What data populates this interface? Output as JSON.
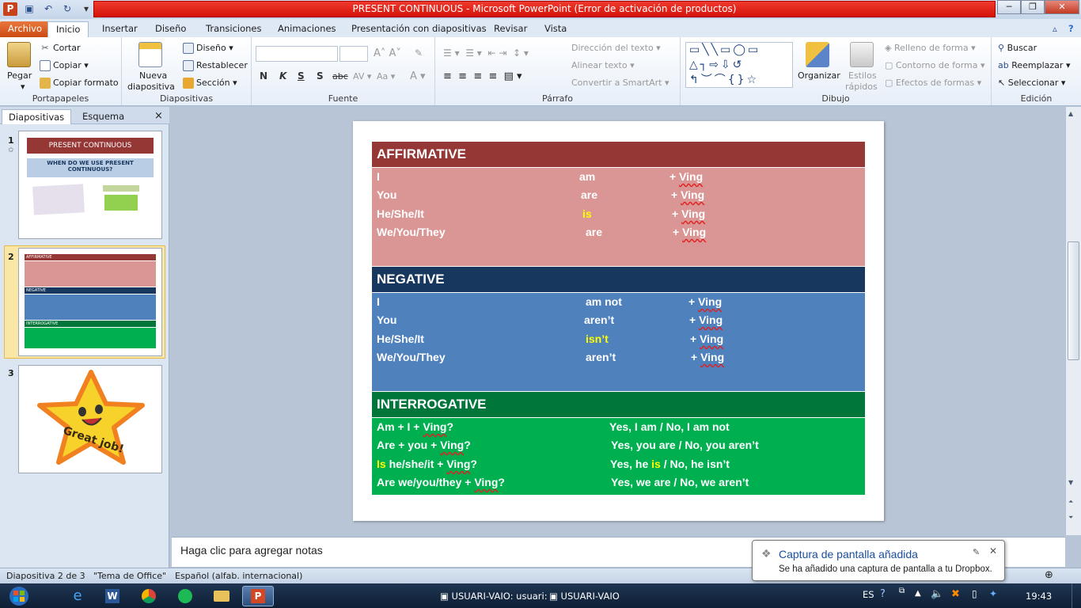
{
  "window": {
    "title": "PRESENT CONTINUOUS  -  Microsoft PowerPoint (Error de activación de productos)"
  },
  "ribbon_tabs": [
    "Archivo",
    "Inicio",
    "Insertar",
    "Diseño",
    "Transiciones",
    "Animaciones",
    "Presentación con diapositivas",
    "Revisar",
    "Vista"
  ],
  "ribbon": {
    "portapapeles": {
      "label": "Portapapeles",
      "pegar": "Pegar",
      "cortar": "Cortar",
      "copiar": "Copiar",
      "copiar_formato": "Copiar formato"
    },
    "diapositivas": {
      "label": "Diapositivas",
      "nueva": "Nueva",
      "diapositiva": "diapositiva",
      "diseno": "Diseño",
      "restablecer": "Restablecer",
      "seccion": "Sección"
    },
    "fuente": {
      "label": "Fuente",
      "n": "N",
      "k": "K",
      "s": "S",
      "abc": "abc"
    },
    "parrafo": {
      "label": "Párrafo",
      "direccion": "Dirección del texto",
      "alinear": "Alinear texto",
      "convertir": "Convertir a SmartArt"
    },
    "dibujo": {
      "label": "Dibujo",
      "organizar": "Organizar",
      "estilos": "Estilos",
      "rapidos": "rápidos",
      "relleno": "Relleno de forma",
      "contorno": "Contorno de forma",
      "efectos": "Efectos de formas"
    },
    "edicion": {
      "label": "Edición",
      "buscar": "Buscar",
      "reemplazar": "Reemplazar",
      "seleccionar": "Seleccionar"
    }
  },
  "left_panel": {
    "tabs": [
      "Diapositivas",
      "Esquema"
    ],
    "close": "×",
    "thumbs": [
      {
        "num": "1",
        "title": "PRESENT CONTINUOUS",
        "subtitle": "WHEN DO WE USE PRESENT CONTINUOUS?"
      },
      {
        "num": "2",
        "aff": "AFFIRMATIVE",
        "neg": "NEGATIVE",
        "int": "INTERROGATIVE"
      },
      {
        "num": "3",
        "label": "Great job!"
      }
    ]
  },
  "slide": {
    "affirmative": {
      "title": "AFFIRMATIVE",
      "rows": [
        {
          "subject": "I",
          "verb": "am",
          "plus": "+ ",
          "ving": "Ving"
        },
        {
          "subject": "You",
          "verb": "are",
          "plus": "+ ",
          "ving": "Ving"
        },
        {
          "subject": "He/She/It",
          "verb": "is",
          "plus": "+ ",
          "ving": "Ving"
        },
        {
          "subject": "We/You/They",
          "verb": "are",
          "plus": "+ ",
          "ving": "Ving"
        }
      ]
    },
    "negative": {
      "title": "NEGATIVE",
      "rows": [
        {
          "subject": "I",
          "verb": "am not",
          "plus": "+ ",
          "ving": "Ving"
        },
        {
          "subject": "You",
          "verb": "aren’t",
          "plus": "+ ",
          "ving": "Ving"
        },
        {
          "subject": "He/She/It",
          "verb": "isn’t",
          "plus": "+ ",
          "ving": "Ving"
        },
        {
          "subject": "We/You/They",
          "verb": "aren’t",
          "plus": "+ ",
          "ving": "Ving"
        }
      ]
    },
    "interrogative": {
      "title": "INTERROGATIVE",
      "rows": [
        {
          "pre": "Am  + I + ",
          "hl": "",
          "mid": "",
          "ving": "Ving",
          "q": "?",
          "a1": "Yes, I am / No, I am not",
          "ahl": "",
          "a2": ""
        },
        {
          "pre": "Are + you + ",
          "hl": "",
          "mid": "",
          "ving": "Ving",
          "q": "?",
          "a1": "Yes, you are / No, you aren’t",
          "ahl": "",
          "a2": ""
        },
        {
          "pre": "",
          "hl": "Is",
          "mid": " he/she/it + ",
          "ving": "Ving",
          "q": "?",
          "a1": "Yes, he ",
          "ahl": "is",
          "a2": " / No, he isn’t"
        },
        {
          "pre": "Are we/you/they + ",
          "hl": "",
          "mid": "",
          "ving": "Ving",
          "q": "?",
          "a1": "Yes, we are / No, we aren’t",
          "ahl": "",
          "a2": ""
        }
      ]
    }
  },
  "notes": {
    "placeholder": "Haga clic para agregar notas"
  },
  "status": {
    "slide": "Diapositiva 2 de 3",
    "theme": "\"Tema de Office\"",
    "lang": "Español (alfab. internacional)"
  },
  "notification": {
    "title": "Captura de pantalla añadida",
    "message": "Se ha añadido una captura de pantalla a tu Dropbox."
  },
  "taskbar": {
    "item1": "USUARI-VAIO: usuari:",
    "item2": "USUARI-VAIO",
    "lang": "ES",
    "time": "19:43"
  },
  "colors": {
    "affirmative_head": "#953735",
    "affirmative_body": "#da9694",
    "negative_head": "#17375e",
    "negative_body": "#4f81bd",
    "interrogative_head": "#00763a",
    "interrogative_body": "#00b050"
  }
}
